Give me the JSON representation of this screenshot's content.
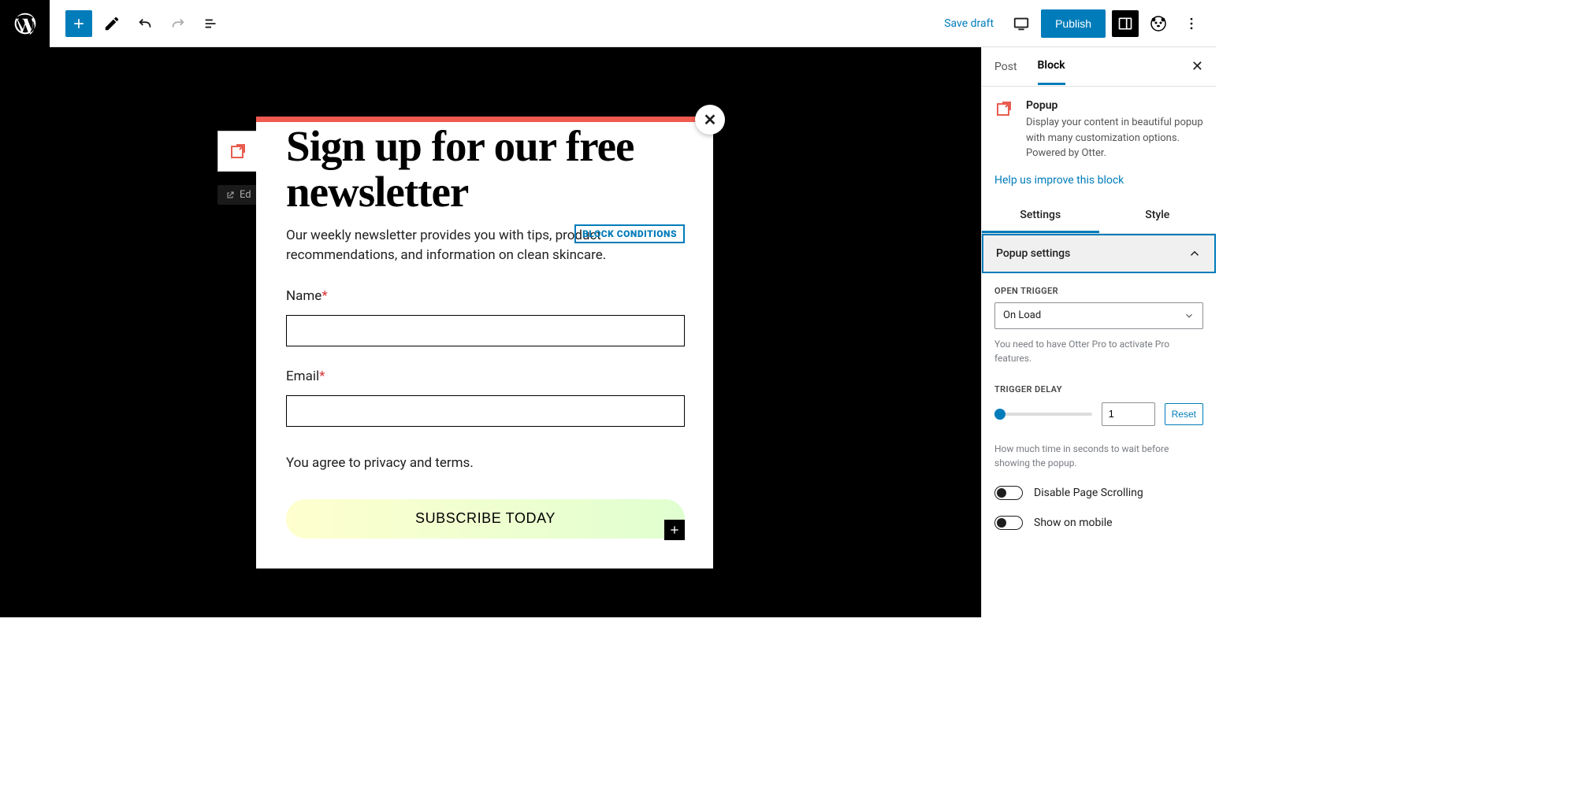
{
  "topbar": {
    "save_draft": "Save draft",
    "publish": "Publish"
  },
  "canvas": {
    "edit_pill": "Ed"
  },
  "popup": {
    "heading": "Sign up for our free newsletter",
    "block_conditions_badge": "BLOCK CONDITIONS",
    "paragraph": "Our weekly newsletter provides you with tips, product recommendations, and information on clean skincare.",
    "name_label": "Name",
    "email_label": "Email",
    "required_mark": "*",
    "agree_text": "You agree to privacy and terms.",
    "subscribe_label": "SUBSCRIBE TODAY",
    "close_symbol": "✕"
  },
  "sidebar": {
    "tabs": {
      "post": "Post",
      "block": "Block"
    },
    "block": {
      "name": "Popup",
      "description": "Display your content in beautiful popup with many customization options. Powered by Otter.",
      "help_link": "Help us improve this block"
    },
    "subtabs": {
      "settings": "Settings",
      "style": "Style"
    },
    "panel": {
      "title": "Popup settings",
      "open_trigger": {
        "label": "OPEN TRIGGER",
        "value": "On Load",
        "hint": "You need to have Otter Pro to activate Pro features."
      },
      "trigger_delay": {
        "label": "TRIGGER DELAY",
        "value": "1",
        "reset": "Reset",
        "hint": "How much time in seconds to wait before showing the popup."
      },
      "disable_scroll": "Disable Page Scrolling",
      "show_mobile": "Show on mobile"
    }
  }
}
